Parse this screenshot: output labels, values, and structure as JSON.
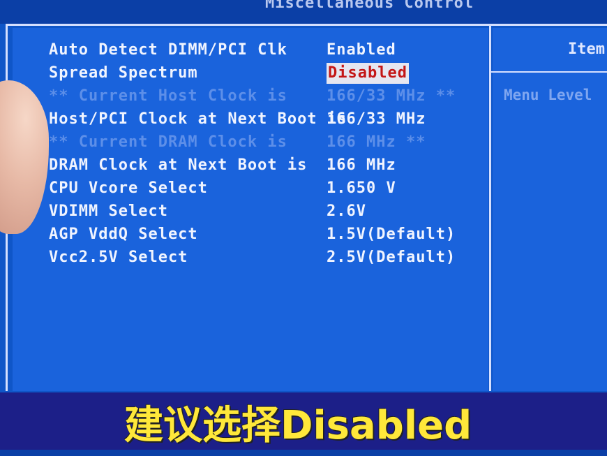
{
  "header": {
    "title": "Miscellaneous Control"
  },
  "settings": [
    {
      "label": "Auto Detect DIMM/PCI Clk",
      "value": "Enabled",
      "state": "normal"
    },
    {
      "label": "Spread Spectrum",
      "value": "Disabled",
      "state": "selected"
    },
    {
      "label": "**  Current Host Clock is",
      "value": "166/33 MHz **",
      "state": "dim"
    },
    {
      "label": "Host/PCI Clock at Next Boot is",
      "value": "166/33 MHz",
      "state": "normal"
    },
    {
      "label": "**  Current DRAM Clock is",
      "value": "166 MHz **",
      "state": "dim"
    },
    {
      "label": "DRAM Clock at Next Boot is",
      "value": "166 MHz",
      "state": "normal"
    },
    {
      "label": "CPU Vcore Select",
      "value": "1.650 V",
      "state": "normal"
    },
    {
      "label": "VDIMM Select",
      "value": "2.6V",
      "state": "normal"
    },
    {
      "label": "AGP VddQ Select",
      "value": "1.5V(Default)",
      "state": "normal"
    },
    {
      "label": "Vcc2.5V Select",
      "value": "2.5V(Default)",
      "state": "normal"
    }
  ],
  "help_panel": {
    "title": "Item",
    "menu_level": "Menu Level"
  },
  "caption": "建议选择Disabled",
  "colors": {
    "background": "#0f56c8",
    "panel": "#1a63dc",
    "text": "#f0f4ff",
    "dim_text": "#5d8fe9",
    "highlight_bg": "#e6e6f0",
    "highlight_text": "#c41616",
    "caption_band": "#1c1f88",
    "caption_text": "#ffe83a"
  }
}
